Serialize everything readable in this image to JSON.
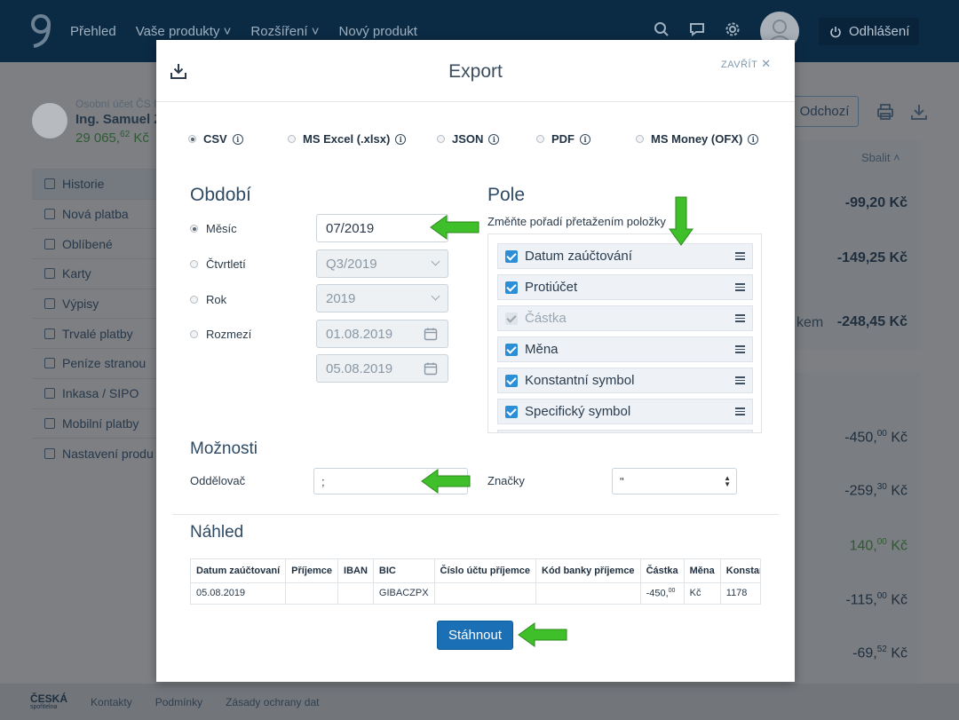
{
  "topbar": {
    "nav": [
      "Přehled",
      "Vaše produkty ˅",
      "Rozšíření ˅",
      "Nový produkt"
    ],
    "logout_label": "Odhlášení"
  },
  "account": {
    "label": "Osobní účet ČS II",
    "name": "Ing. Samuel Z",
    "balance_main": "29 065,",
    "balance_dec": "62",
    "balance_cur": " Kč"
  },
  "sidemenu": [
    "Historie",
    "Nová platba",
    "Oblíbené",
    "Karty",
    "Výpisy",
    "Trvalé platby",
    "Peníze stranou",
    "Inkasa / SIPO",
    "Mobilní platby",
    "Nastavení produ"
  ],
  "right_panel": {
    "odchozi_label": "Odchozí",
    "sbalit_label": "Sbalit",
    "top_amounts": [
      "-99,20 Kč",
      "-149,25 Kč",
      "-248,45 Kč"
    ],
    "sum_label": "kem",
    "list_amounts": [
      {
        "main": "-450,",
        "dec": "00",
        "cur": " Kč",
        "positive": false
      },
      {
        "main": "-259,",
        "dec": "30",
        "cur": " Kč",
        "positive": false
      },
      {
        "main": "140,",
        "dec": "00",
        "cur": " Kč",
        "positive": true
      },
      {
        "main": "-115,",
        "dec": "00",
        "cur": " Kč",
        "positive": false
      },
      {
        "main": "-69,",
        "dec": "52",
        "cur": " Kč",
        "positive": false
      }
    ]
  },
  "footer": {
    "brand_line1": "ČESKÁ",
    "brand_line2": "spořitelna",
    "links": [
      "Kontakty",
      "Podmínky",
      "Zásady ochrany dat"
    ]
  },
  "modal": {
    "title": "Export",
    "close_label": "ZAVŘÍT",
    "formats": [
      {
        "label": "CSV",
        "selected": true
      },
      {
        "label": "MS Excel (.xlsx)",
        "selected": false
      },
      {
        "label": "JSON",
        "selected": false
      },
      {
        "label": "PDF",
        "selected": false
      },
      {
        "label": "MS Money (OFX)",
        "selected": false
      }
    ],
    "period": {
      "title": "Období",
      "options": [
        "Měsíc",
        "Čtvrtletí",
        "Rok",
        "Rozmezí"
      ],
      "month_value": "07/2019",
      "quarter_value": "Q3/2019",
      "year_value": "2019",
      "from_value": "01.08.2019",
      "to_value": "05.08.2019"
    },
    "fields": {
      "title": "Pole",
      "hint": "Změňte pořadí přetažením položky",
      "items": [
        {
          "label": "Datum zaúčtování",
          "checked": true,
          "disabled": false
        },
        {
          "label": "Protiúčet",
          "checked": true,
          "disabled": false
        },
        {
          "label": "Částka",
          "checked": true,
          "disabled": true
        },
        {
          "label": "Měna",
          "checked": true,
          "disabled": false
        },
        {
          "label": "Konstantní symbol",
          "checked": true,
          "disabled": false
        },
        {
          "label": "Specifický symbol",
          "checked": true,
          "disabled": false
        }
      ]
    },
    "options": {
      "title": "Možnosti",
      "separator_label": "Oddělovač",
      "separator_value": ";",
      "quotes_label": "Značky",
      "quotes_value": "\""
    },
    "preview": {
      "title": "Náhled",
      "columns": [
        "Datum zaúčtovaní",
        "Příjemce",
        "IBAN",
        "BIC",
        "Číslo účtu příjemce",
        "Kód banky příjemce",
        "Částka",
        "Měna",
        "Konstantní s"
      ],
      "row": [
        "05.08.2019",
        "",
        "",
        "GIBACZPX",
        "",
        "",
        "-450,",
        "Kč",
        "1178"
      ],
      "row_amount_dec": "00"
    },
    "download_label": "Stáhnout"
  },
  "colors": {
    "topbar": "#0b2b45",
    "primary_button": "#1b6fb5",
    "checkbox": "#2d8ed8",
    "arrow_green": "#3fbf2a"
  }
}
